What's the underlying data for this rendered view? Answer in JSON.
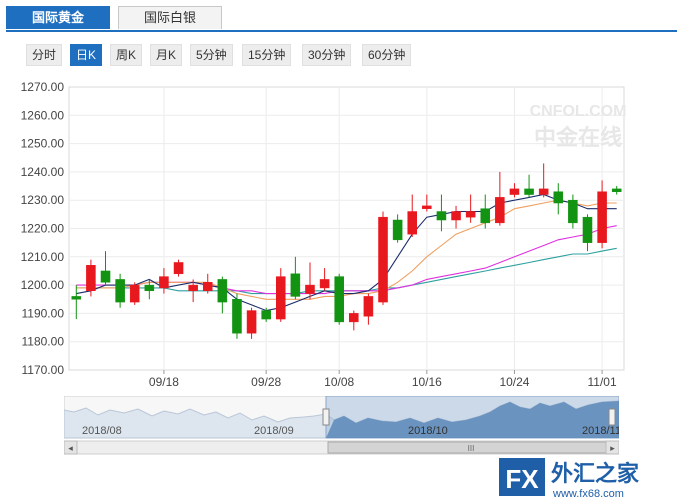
{
  "tabs": [
    "国际黄金",
    "国际白银"
  ],
  "periods": [
    "分时",
    "日K",
    "周K",
    "月K",
    "5分钟",
    "15分钟",
    "30分钟",
    "60分钟"
  ],
  "active_period": "日K",
  "watermark": {
    "brand": "CNFOL.COM",
    "cn": "中金在线"
  },
  "navigator": {
    "labels": [
      "2018/08",
      "2018/09",
      "2018/10",
      "2018/11"
    ],
    "scroll_glyph": "III",
    "left_arrow": "◂",
    "right_arrow": "▸"
  },
  "logo": {
    "fx": "FX",
    "cn": "外汇之家",
    "url": "www.fx68.com"
  },
  "chart_data": {
    "type": "candlestick",
    "ylim": [
      1170,
      1270
    ],
    "yticks": [
      "1270.00",
      "1260.00",
      "1250.00",
      "1240.00",
      "1230.00",
      "1220.00",
      "1210.00",
      "1200.00",
      "1190.00",
      "1180.00",
      "1170.00"
    ],
    "xticks": [
      {
        "label": "09/18",
        "index": 6
      },
      {
        "label": "09/28",
        "index": 13
      },
      {
        "label": "10/08",
        "index": 18
      },
      {
        "label": "10/16",
        "index": 24
      },
      {
        "label": "10/24",
        "index": 30
      },
      {
        "label": "11/01",
        "index": 36
      }
    ],
    "colors": {
      "up": "#e8191e",
      "down": "#129312",
      "ma5": "#1a2d6b",
      "ma10": "#f0a060",
      "ma20": "#e030e0",
      "ma30": "#2ea0a0"
    },
    "candles": [
      {
        "o": 1196.0,
        "c": 1195.0,
        "h": 1200.0,
        "l": 1188.0
      },
      {
        "o": 1198.0,
        "c": 1207.0,
        "h": 1209.0,
        "l": 1196.0
      },
      {
        "o": 1205.0,
        "c": 1201.0,
        "h": 1212.0,
        "l": 1200.0
      },
      {
        "o": 1202.0,
        "c": 1194.0,
        "h": 1204.0,
        "l": 1192.0
      },
      {
        "o": 1194.0,
        "c": 1200.0,
        "h": 1201.0,
        "l": 1193.0
      },
      {
        "o": 1200.0,
        "c": 1198.0,
        "h": 1202.0,
        "l": 1195.0
      },
      {
        "o": 1199.0,
        "c": 1203.0,
        "h": 1206.0,
        "l": 1197.0
      },
      {
        "o": 1204.0,
        "c": 1208.0,
        "h": 1209.0,
        "l": 1203.0
      },
      {
        "o": 1198.0,
        "c": 1200.0,
        "h": 1202.0,
        "l": 1194.0
      },
      {
        "o": 1198.0,
        "c": 1201.0,
        "h": 1204.0,
        "l": 1197.0
      },
      {
        "o": 1202.0,
        "c": 1194.0,
        "h": 1203.0,
        "l": 1190.0
      },
      {
        "o": 1195.0,
        "c": 1183.0,
        "h": 1197.0,
        "l": 1181.0
      },
      {
        "o": 1183.0,
        "c": 1191.0,
        "h": 1192.0,
        "l": 1181.0
      },
      {
        "o": 1191.0,
        "c": 1188.0,
        "h": 1192.0,
        "l": 1187.0
      },
      {
        "o": 1188.0,
        "c": 1203.0,
        "h": 1206.0,
        "l": 1187.0
      },
      {
        "o": 1204.0,
        "c": 1196.0,
        "h": 1210.0,
        "l": 1195.0
      },
      {
        "o": 1197.0,
        "c": 1200.0,
        "h": 1208.0,
        "l": 1195.0
      },
      {
        "o": 1199.0,
        "c": 1202.0,
        "h": 1206.0,
        "l": 1198.0
      },
      {
        "o": 1203.0,
        "c": 1187.0,
        "h": 1204.0,
        "l": 1186.0
      },
      {
        "o": 1187.0,
        "c": 1190.0,
        "h": 1191.0,
        "l": 1184.0
      },
      {
        "o": 1189.0,
        "c": 1196.0,
        "h": 1197.0,
        "l": 1186.0
      },
      {
        "o": 1194.0,
        "c": 1224.0,
        "h": 1226.0,
        "l": 1193.0
      },
      {
        "o": 1223.0,
        "c": 1216.0,
        "h": 1225.0,
        "l": 1215.0
      },
      {
        "o": 1218.0,
        "c": 1226.0,
        "h": 1232.0,
        "l": 1217.0
      },
      {
        "o": 1227.0,
        "c": 1228.0,
        "h": 1232.0,
        "l": 1226.0
      },
      {
        "o": 1226.0,
        "c": 1223.0,
        "h": 1232.0,
        "l": 1219.0
      },
      {
        "o": 1223.0,
        "c": 1226.0,
        "h": 1228.0,
        "l": 1220.0
      },
      {
        "o": 1224.0,
        "c": 1226.0,
        "h": 1232.0,
        "l": 1222.0
      },
      {
        "o": 1227.0,
        "c": 1222.0,
        "h": 1232.0,
        "l": 1220.0
      },
      {
        "o": 1222.0,
        "c": 1231.0,
        "h": 1240.0,
        "l": 1221.0
      },
      {
        "o": 1232.0,
        "c": 1234.0,
        "h": 1236.0,
        "l": 1231.0
      },
      {
        "o": 1234.0,
        "c": 1232.0,
        "h": 1239.0,
        "l": 1231.0
      },
      {
        "o": 1232.0,
        "c": 1234.0,
        "h": 1243.0,
        "l": 1231.0
      },
      {
        "o": 1233.0,
        "c": 1229.0,
        "h": 1236.0,
        "l": 1225.0
      },
      {
        "o": 1230.0,
        "c": 1222.0,
        "h": 1232.0,
        "l": 1220.0
      },
      {
        "o": 1224.0,
        "c": 1215.0,
        "h": 1225.0,
        "l": 1212.0
      },
      {
        "o": 1215.0,
        "c": 1233.0,
        "h": 1237.0,
        "l": 1213.0
      },
      {
        "o": 1234.0,
        "c": 1233.0,
        "h": 1235.0,
        "l": 1232.0
      }
    ],
    "ma5": [
      1197,
      1198,
      1200,
      1200,
      1200,
      1202,
      1199,
      1200,
      1201,
      1200,
      1199,
      1195,
      1193,
      1191,
      1192,
      1194,
      1196,
      1198,
      1197,
      1197,
      1198,
      1202,
      1210,
      1218,
      1224,
      1225,
      1226,
      1226,
      1226,
      1229,
      1230,
      1231,
      1232,
      1230,
      1229,
      1227,
      1227,
      1227
    ],
    "ma10": [
      1199,
      1199,
      1199,
      1199,
      1200,
      1201,
      1201,
      1201,
      1201,
      1201,
      1199,
      1197,
      1196,
      1195,
      1195,
      1195,
      1195,
      1196,
      1196,
      1197,
      1197,
      1198,
      1201,
      1205,
      1210,
      1214,
      1218,
      1220,
      1222,
      1224,
      1227,
      1228,
      1229,
      1230,
      1229,
      1228,
      1229,
      1229
    ],
    "ma20": [
      1200,
      1200,
      1200,
      1200,
      1200,
      1201,
      1201,
      1201,
      1201,
      1200,
      1199,
      1198,
      1198,
      1197,
      1197,
      1197,
      1197,
      1197,
      1198,
      1198,
      1198,
      1198,
      1199,
      1200,
      1202,
      1203,
      1204,
      1205,
      1206,
      1208,
      1210,
      1212,
      1214,
      1216,
      1217,
      1218,
      1220,
      1221
    ],
    "ma30": [
      1199,
      1199,
      1199,
      1199,
      1199,
      1199,
      1199,
      1198,
      1198,
      1198,
      1198,
      1198,
      1197,
      1197,
      1197,
      1197,
      1198,
      1198,
      1198,
      1198,
      1198,
      1199,
      1199,
      1200,
      1201,
      1202,
      1203,
      1204,
      1205,
      1206,
      1207,
      1208,
      1209,
      1210,
      1211,
      1211,
      1212,
      1213
    ]
  }
}
